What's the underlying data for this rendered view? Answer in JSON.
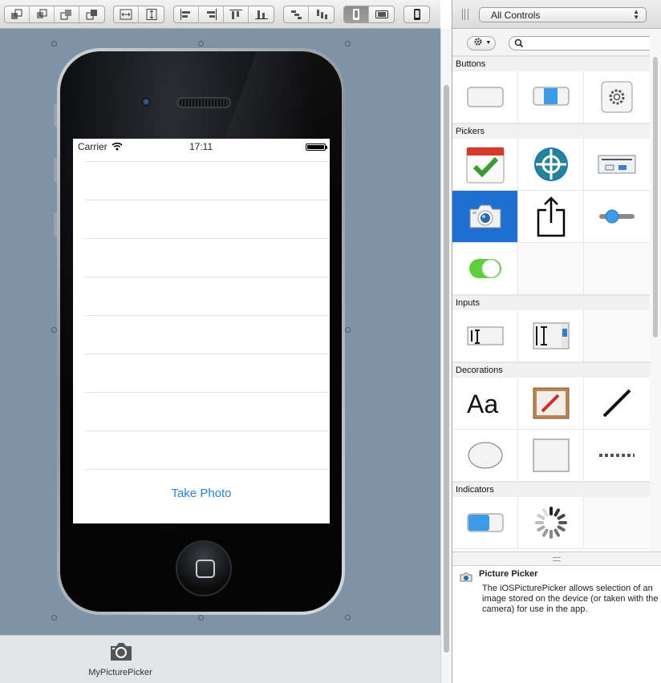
{
  "toolbar": {
    "groups": [
      {
        "name": "arrange",
        "icons": [
          "send-to-back-icon",
          "send-backward-icon",
          "bring-forward-icon",
          "bring-to-front-icon"
        ]
      },
      {
        "name": "size",
        "icons": [
          "equal-width-icon",
          "equal-height-icon"
        ]
      },
      {
        "name": "align",
        "icons": [
          "align-left-icon",
          "align-right-icon",
          "align-top-icon",
          "align-bottom-icon"
        ]
      },
      {
        "name": "distribute",
        "icons": [
          "distribute-horizontal-icon",
          "distribute-vertical-icon"
        ]
      },
      {
        "name": "orientation",
        "icons": [
          "portrait-icon",
          "landscape-icon"
        ]
      },
      {
        "name": "device",
        "icons": [
          "iphone-icon"
        ]
      }
    ]
  },
  "phone": {
    "status": {
      "carrier": "Carrier",
      "time": "17:11"
    },
    "table_rows": 8,
    "take_photo": "Take Photo"
  },
  "dock": {
    "component_label": "MyPicturePicker"
  },
  "library": {
    "filter_select": "All Controls",
    "search_placeholder": "",
    "sections": [
      {
        "title": "Buttons",
        "items": [
          "button",
          "segmented-button",
          "gear-button"
        ]
      },
      {
        "title": "Pickers",
        "items": [
          "date-picker",
          "location-picker",
          "message-box",
          "picture-picker",
          "share-picker",
          "slider",
          "switch"
        ]
      },
      {
        "title": "Inputs",
        "items": [
          "text-field",
          "text-area"
        ]
      },
      {
        "title": "Decorations",
        "items": [
          "label",
          "image",
          "line",
          "ellipse",
          "rectangle",
          "dotted-line"
        ]
      },
      {
        "title": "Indicators",
        "items": [
          "progress-bar",
          "activity-indicator"
        ]
      }
    ],
    "selected": "picture-picker"
  },
  "info": {
    "title": "Picture Picker",
    "description": "The iOSPicturePicker allows selection of an image stored on the device (or taken with the camera) for use in the app."
  },
  "colors": {
    "canvas": "#7f93a6",
    "selection": "#1f6fd0",
    "link": "#2a82d2"
  }
}
